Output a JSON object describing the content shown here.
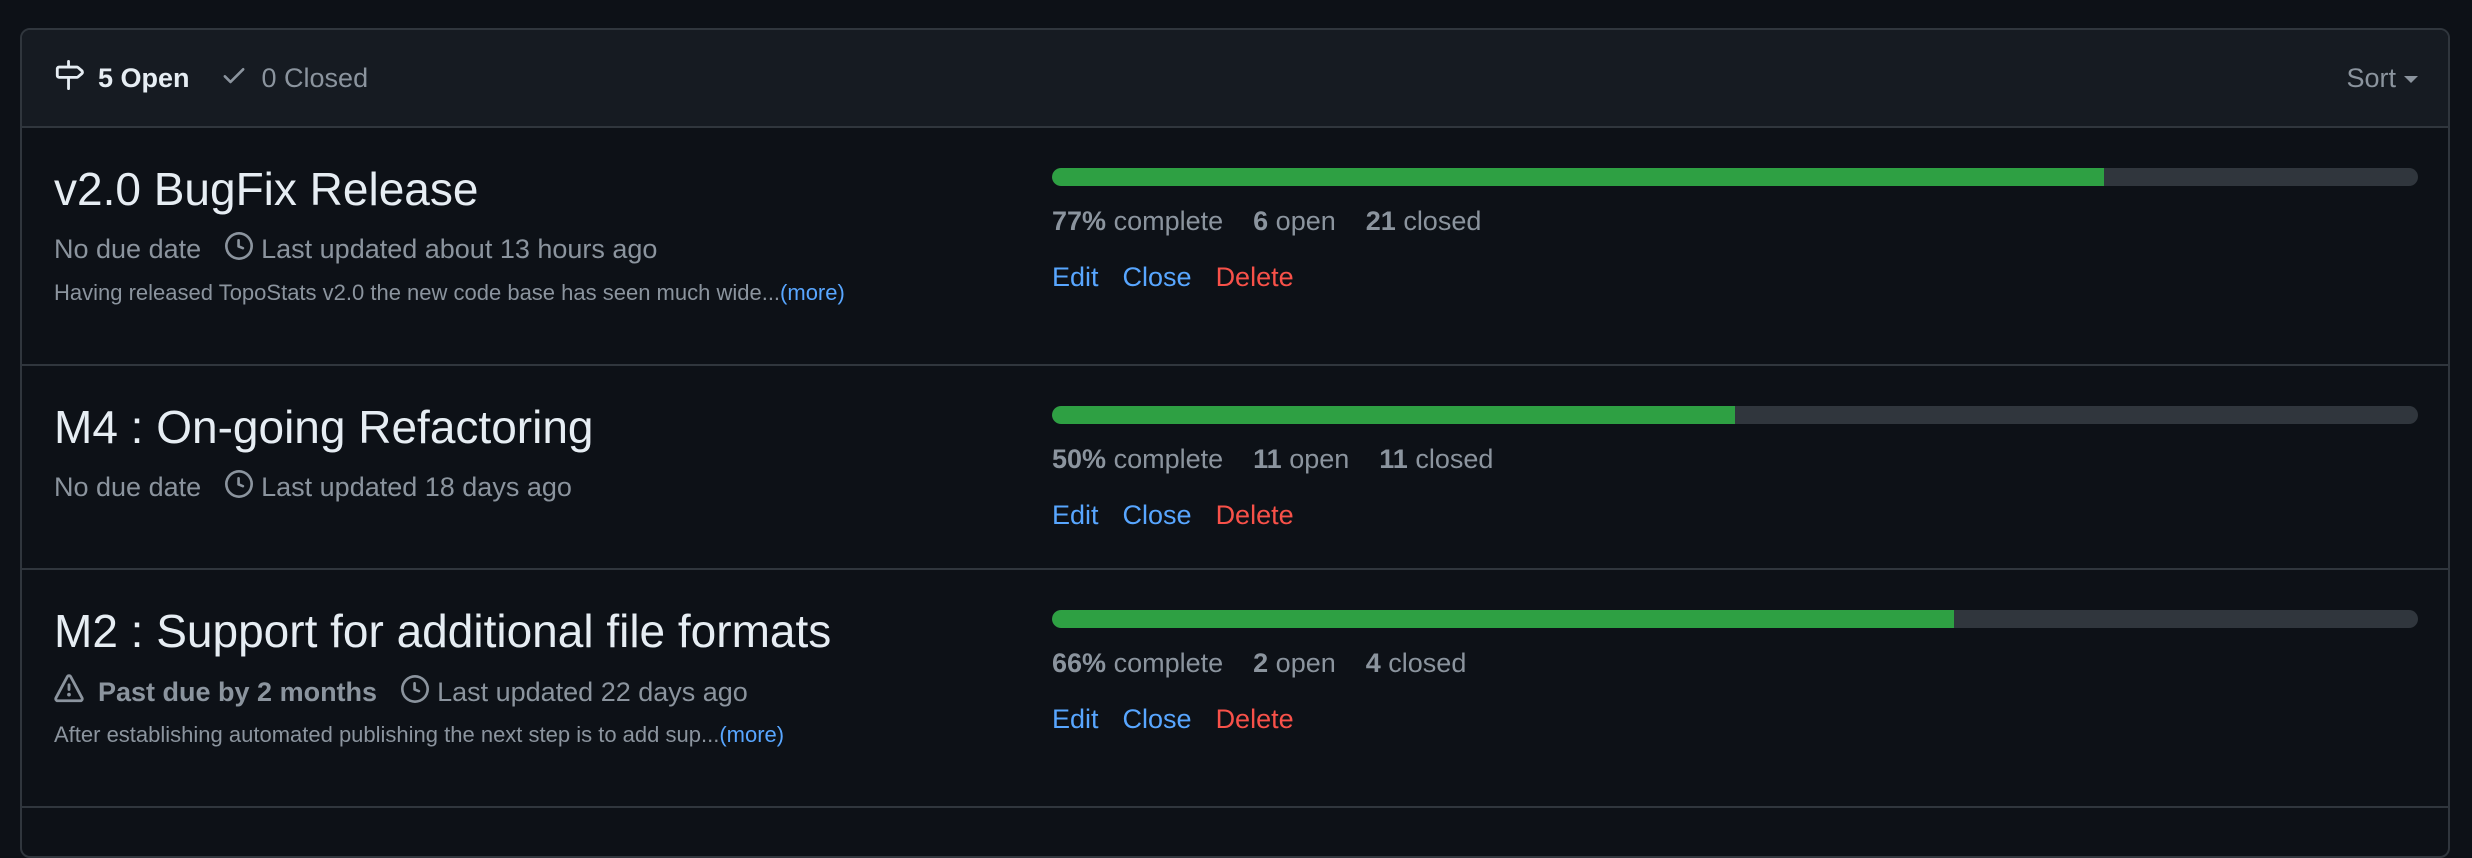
{
  "header": {
    "open_label": "5 Open",
    "closed_label": "0 Closed",
    "sort_label": "Sort"
  },
  "milestones": [
    {
      "title": "v2.0 BugFix Release",
      "due": "No due date",
      "updated": "Last updated about 13 hours ago",
      "description": "Having released TopoStats v2.0 the new code base has seen much wide...",
      "more_label": "(more)",
      "percent": 77,
      "percent_label": "77%",
      "complete_label": "complete",
      "open_count": "6",
      "open_label": "open",
      "closed_count": "21",
      "closed_label": "closed",
      "edit_label": "Edit",
      "close_label": "Close",
      "delete_label": "Delete"
    },
    {
      "title": "M4 : On-going Refactoring",
      "due": "No due date",
      "updated": "Last updated 18 days ago",
      "percent": 50,
      "percent_label": "50%",
      "complete_label": "complete",
      "open_count": "11",
      "open_label": "open",
      "closed_count": "11",
      "closed_label": "closed",
      "edit_label": "Edit",
      "close_label": "Close",
      "delete_label": "Delete"
    },
    {
      "title": "M2 : Support for additional file formats",
      "due": "Past due by 2 months",
      "updated": "Last updated 22 days ago",
      "description": "After establishing automated publishing the next step is to add sup...",
      "more_label": "(more)",
      "percent": 66,
      "percent_label": "66%",
      "complete_label": "complete",
      "open_count": "2",
      "open_label": "open",
      "closed_count": "4",
      "closed_label": "closed",
      "edit_label": "Edit",
      "close_label": "Close",
      "delete_label": "Delete"
    }
  ],
  "colors": {
    "progress_fill": "#2ea043",
    "progress_track": "#30363d",
    "link": "#58a6ff",
    "danger": "#f85149"
  }
}
